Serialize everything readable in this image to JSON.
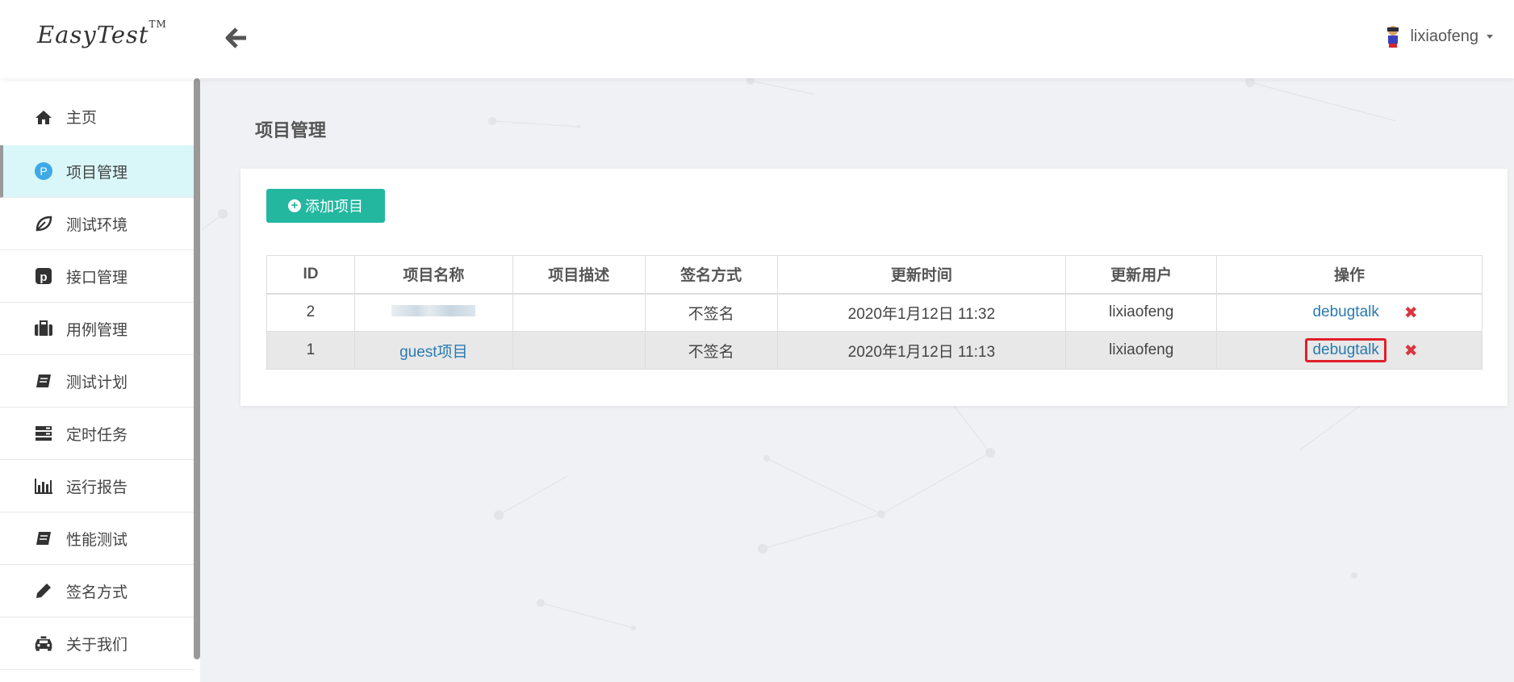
{
  "header": {
    "logo": "EasyTest",
    "logo_tm": "TM",
    "user": "lixiaofeng"
  },
  "sidebar": {
    "items": [
      {
        "label": "主页",
        "icon": "home-icon"
      },
      {
        "label": "项目管理",
        "icon": "project-p-icon",
        "active": true
      },
      {
        "label": "测试环境",
        "icon": "leaf-icon"
      },
      {
        "label": "接口管理",
        "icon": "pinterest-icon"
      },
      {
        "label": "用例管理",
        "icon": "suitcase-icon"
      },
      {
        "label": "测试计划",
        "icon": "book-icon"
      },
      {
        "label": "定时任务",
        "icon": "server-icon"
      },
      {
        "label": "运行报告",
        "icon": "bar-chart-icon"
      },
      {
        "label": "性能测试",
        "icon": "book-icon"
      },
      {
        "label": "签名方式",
        "icon": "pencil-icon"
      },
      {
        "label": "关于我们",
        "icon": "taxi-icon"
      }
    ]
  },
  "main": {
    "title": "项目管理",
    "add_button": "添加项目",
    "accent": "#23b7a0",
    "table": {
      "columns": [
        "ID",
        "项目名称",
        "项目描述",
        "签名方式",
        "更新时间",
        "更新用户",
        "操作"
      ],
      "rows": [
        {
          "id": "2",
          "name": "",
          "desc": "",
          "sign": "不签名",
          "updated": "2020年1月12日 11:32",
          "user": "lixiaofeng",
          "action": "debugtalk"
        },
        {
          "id": "1",
          "name": "guest项目",
          "desc": "",
          "sign": "不签名",
          "updated": "2020年1月12日 11:13",
          "user": "lixiaofeng",
          "action": "debugtalk"
        }
      ]
    }
  }
}
